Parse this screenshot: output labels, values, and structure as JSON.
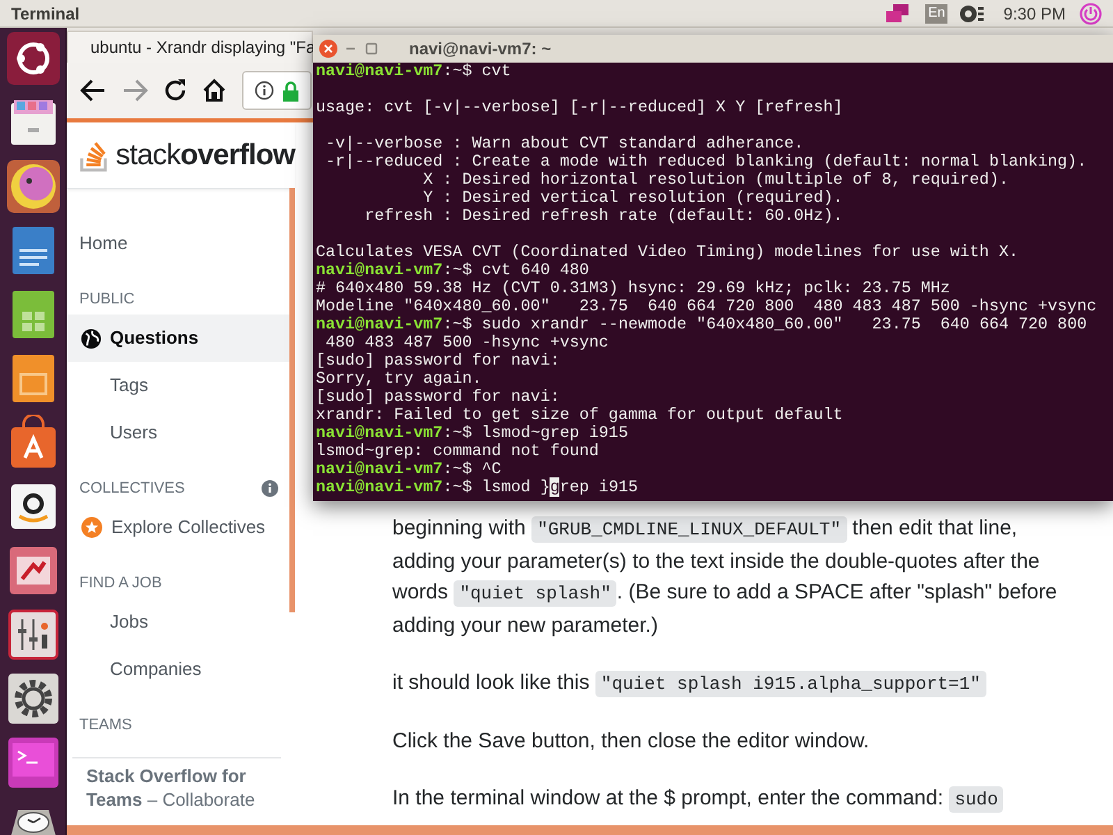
{
  "top_panel": {
    "app_name": "Terminal",
    "keyboard_layout": "En",
    "clock": "9:30 PM"
  },
  "browser": {
    "tab": {
      "title": "ubuntu - Xrandr displaying \"Fa"
    },
    "logo": {
      "light": "stack",
      "bold": "overflow"
    },
    "sidebar": [
      {
        "kind": "link",
        "label": "Home",
        "selected": false
      },
      {
        "kind": "heading",
        "label": "PUBLIC"
      },
      {
        "kind": "globe-link",
        "label": "Questions",
        "selected": true
      },
      {
        "kind": "sublink",
        "label": "Tags",
        "selected": false
      },
      {
        "kind": "sublink",
        "label": "Users",
        "selected": false
      },
      {
        "kind": "heading-info",
        "label": "COLLECTIVES"
      },
      {
        "kind": "collective",
        "label": "Explore Collectives",
        "selected": false
      },
      {
        "kind": "heading",
        "label": "FIND A JOB"
      },
      {
        "kind": "sublink",
        "label": "Jobs",
        "selected": false
      },
      {
        "kind": "sublink",
        "label": "Companies",
        "selected": false
      },
      {
        "kind": "heading",
        "label": "TEAMS"
      }
    ],
    "teams_promo": "**Stack Overflow for Teams** – Collaborate",
    "article": [
      [
        {
          "kind": "text",
          "text": "beginning with "
        },
        {
          "kind": "code",
          "text": "\"GRUB_CMDLINE_LINUX_DEFAULT\""
        },
        {
          "kind": "text",
          "text": " then edit that line, adding your parameter(s) to the text inside the double-quotes after the words "
        },
        {
          "kind": "code",
          "text": "\"quiet splash\""
        },
        {
          "kind": "text",
          "text": ". (Be sure to add a SPACE after \"splash\" before adding your new parameter.)"
        }
      ],
      [
        {
          "kind": "text",
          "text": "it should look like this "
        },
        {
          "kind": "code",
          "text": "\"quiet splash i915.alpha_support=1\""
        }
      ],
      [
        {
          "kind": "text",
          "text": "Click the Save button, then close the editor window."
        }
      ],
      [
        {
          "kind": "text",
          "text": "In the terminal window at the $ prompt, enter the command: "
        },
        {
          "kind": "code",
          "text": "sudo"
        }
      ]
    ]
  },
  "terminal": {
    "title": "navi@navi-vm7: ~",
    "lines": [
      {
        "kind": "prompt",
        "user": "navi@navi-vm7",
        "suffix": ":~$",
        "command": "cvt"
      },
      {
        "kind": "blank"
      },
      {
        "kind": "output",
        "text": "usage: cvt [-v|--verbose] [-r|--reduced] X Y [refresh]"
      },
      {
        "kind": "blank"
      },
      {
        "kind": "output",
        "text": " -v|--verbose : Warn about CVT standard adherance."
      },
      {
        "kind": "output",
        "text": " -r|--reduced : Create a mode with reduced blanking (default: normal blanking)."
      },
      {
        "kind": "output",
        "text": "           X : Desired horizontal resolution (multiple of 8, required)."
      },
      {
        "kind": "output",
        "text": "           Y : Desired vertical resolution (required)."
      },
      {
        "kind": "output",
        "text": "     refresh : Desired refresh rate (default: 60.0Hz)."
      },
      {
        "kind": "blank"
      },
      {
        "kind": "output",
        "text": "Calculates VESA CVT (Coordinated Video Timing) modelines for use with X."
      },
      {
        "kind": "prompt",
        "user": "navi@navi-vm7",
        "suffix": ":~$",
        "command": "cvt 640 480"
      },
      {
        "kind": "output",
        "text": "# 640x480 59.38 Hz (CVT 0.31M3) hsync: 29.69 kHz; pclk: 23.75 MHz"
      },
      {
        "kind": "output",
        "text": "Modeline \"640x480_60.00\"   23.75  640 664 720 800  480 483 487 500 -hsync +vsync"
      },
      {
        "kind": "prompt",
        "user": "navi@navi-vm7",
        "suffix": ":~$",
        "command": "sudo xrandr --newmode \"640x480_60.00\"   23.75  640 664 720 800"
      },
      {
        "kind": "output",
        "text": " 480 483 487 500 -hsync +vsync"
      },
      {
        "kind": "output",
        "text": "[sudo] password for navi:"
      },
      {
        "kind": "output",
        "text": "Sorry, try again."
      },
      {
        "kind": "output",
        "text": "[sudo] password for navi:"
      },
      {
        "kind": "output",
        "text": "xrandr: Failed to get size of gamma for output default"
      },
      {
        "kind": "prompt",
        "user": "navi@navi-vm7",
        "suffix": ":~$",
        "command": "lsmod~grep i915"
      },
      {
        "kind": "output",
        "text": "lsmod~grep: command not found"
      },
      {
        "kind": "prompt",
        "user": "navi@navi-vm7",
        "suffix": ":~$",
        "command": "^C"
      },
      {
        "kind": "prompt",
        "user": "navi@navi-vm7",
        "suffix": ":~$",
        "command": "lsmod }",
        "cursor": "g",
        "command_after": "rep i915"
      }
    ]
  }
}
